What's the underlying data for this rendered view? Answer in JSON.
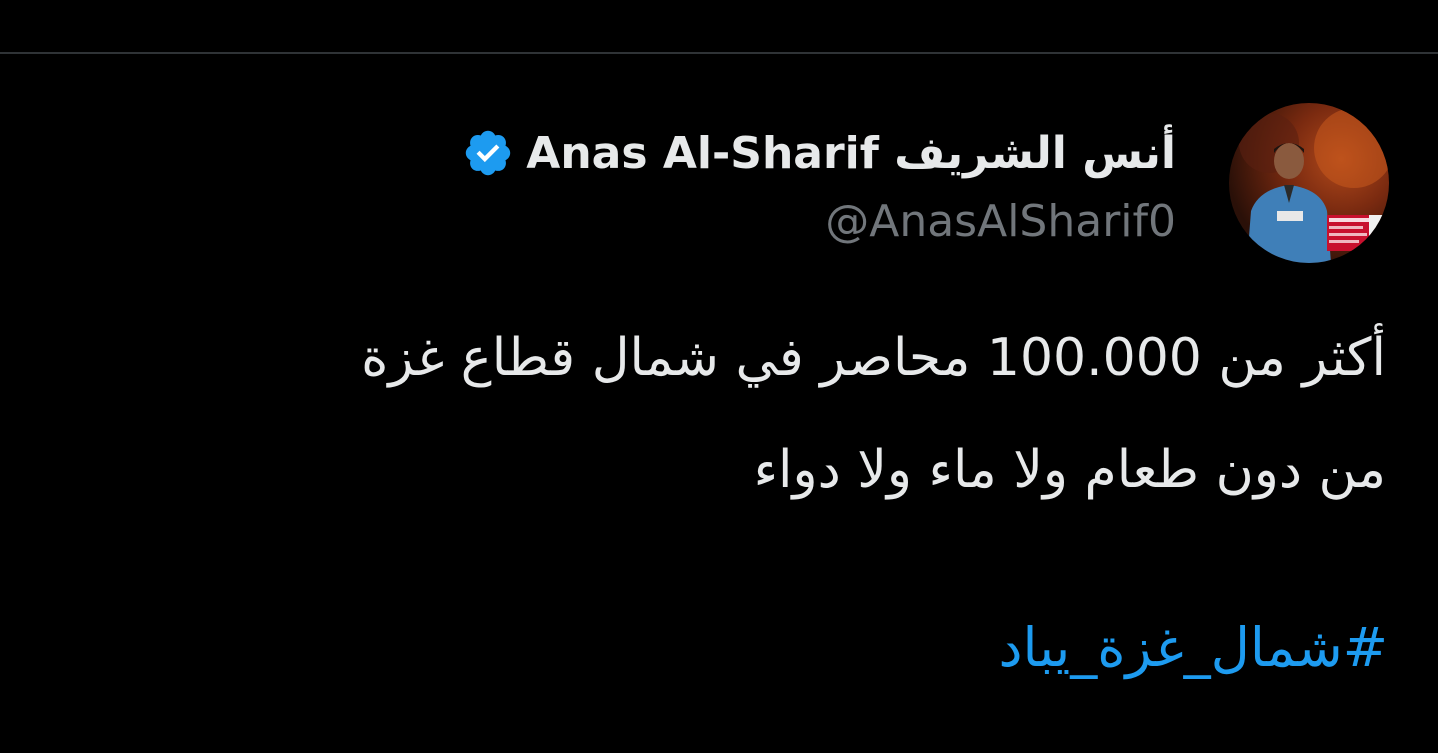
{
  "author": {
    "display_name": "أنس الشريف Anas Al-Sharif",
    "handle": "@AnasAlSharif0",
    "verified": true
  },
  "tweet": {
    "lines": [
      "أكثر من 100.000 محاصر في شمال قطاع غزة",
      "من دون طعام ولا ماء ولا دواء"
    ],
    "hashtag": "#شمال_غزة_يباد"
  },
  "colors": {
    "background": "#000000",
    "text": "#e7e9ea",
    "secondary_text": "#71767b",
    "link": "#1d9bf0",
    "verified_badge": "#1d9bf0",
    "divider": "#2f3336"
  },
  "icons": {
    "verified": "verified-badge-icon"
  }
}
